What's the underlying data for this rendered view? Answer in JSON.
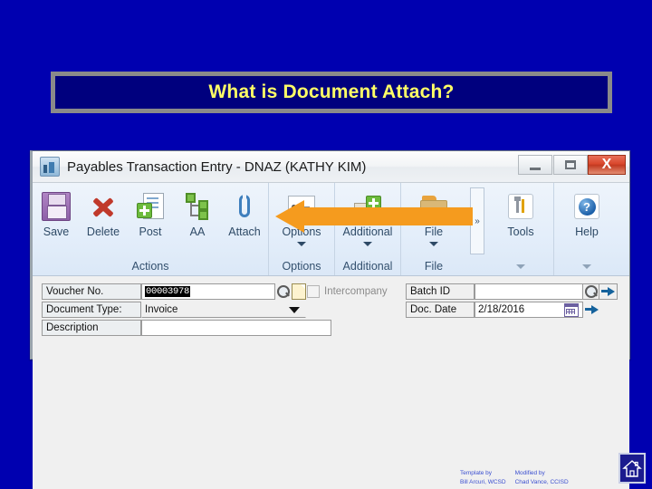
{
  "slide": {
    "title": "What is Document Attach?",
    "title_color": "#FFFF66",
    "background_color": "#0000B0",
    "title_box_fill": "#00007E",
    "title_box_border": "#8A8A8A"
  },
  "window": {
    "title": "Payables Transaction Entry  -  DNAZ (KATHY KIM)",
    "app_icon": "application-icon",
    "controls": {
      "minimize": "minimize-button",
      "maximize": "maximize-button",
      "close_label": "X",
      "close_color": "#C33A21"
    }
  },
  "ribbon": {
    "expand_label": "»",
    "groups": [
      {
        "label": "Actions",
        "buttons": [
          {
            "label": "Save",
            "icon": "save-floppy-icon",
            "caret": false
          },
          {
            "label": "Delete",
            "icon": "delete-red-x-icon",
            "caret": false
          },
          {
            "label": "Post",
            "icon": "post-document-plus-icon",
            "caret": false
          },
          {
            "label": "AA",
            "icon": "analytical-accounting-icon",
            "caret": false
          },
          {
            "label": "Attach",
            "icon": "attach-paperclip-icon",
            "caret": false
          }
        ]
      },
      {
        "label": "Options",
        "buttons": [
          {
            "label": "Options",
            "icon": "options-page-icon",
            "caret": true
          }
        ]
      },
      {
        "label": "Additional",
        "buttons": [
          {
            "label": "Additional",
            "icon": "additional-plus-icon",
            "caret": true
          }
        ]
      },
      {
        "label": "File",
        "buttons": [
          {
            "label": "File",
            "icon": "file-folder-icon",
            "caret": true
          }
        ]
      },
      {
        "label": "",
        "buttons": [
          {
            "label": "Tools",
            "icon": "tools-wrench-icon",
            "caret": true
          }
        ]
      },
      {
        "label": "",
        "buttons": [
          {
            "label": "Help",
            "icon": "help-question-icon",
            "caret": true,
            "glyph": "?"
          }
        ]
      }
    ]
  },
  "form": {
    "voucher": {
      "label": "Voucher No.",
      "value": "00003978",
      "lookup_icon": "lookup-magnifier-icon",
      "new_icon": "new-document-icon"
    },
    "doctype": {
      "label": "Document Type:",
      "value": "Invoice",
      "caret_icon": "chevron-down-icon"
    },
    "description": {
      "label": "Description",
      "value": ""
    },
    "intercompany": {
      "label": "Intercompany",
      "checked": false
    },
    "batch": {
      "label": "Batch ID",
      "value": "",
      "lookup_icon": "lookup-magnifier-icon",
      "goto_icon": "goto-arrow-icon"
    },
    "docdate": {
      "label": "Doc. Date",
      "value": "2/18/2016",
      "calendar_icon": "calendar-icon",
      "goto_icon": "goto-arrow-icon"
    }
  },
  "annotation": {
    "arrow": {
      "name": "orange-left-arrow",
      "color": "#F59B1E",
      "points_to": "Attach"
    }
  },
  "footer": {
    "template_by_label": "Template by",
    "template_by_name": "Bill Arcuri, WCSD",
    "modified_by_label": "Modified by",
    "modified_by_name": "Chad Vance, CCISD",
    "home_icon": "home-icon"
  }
}
